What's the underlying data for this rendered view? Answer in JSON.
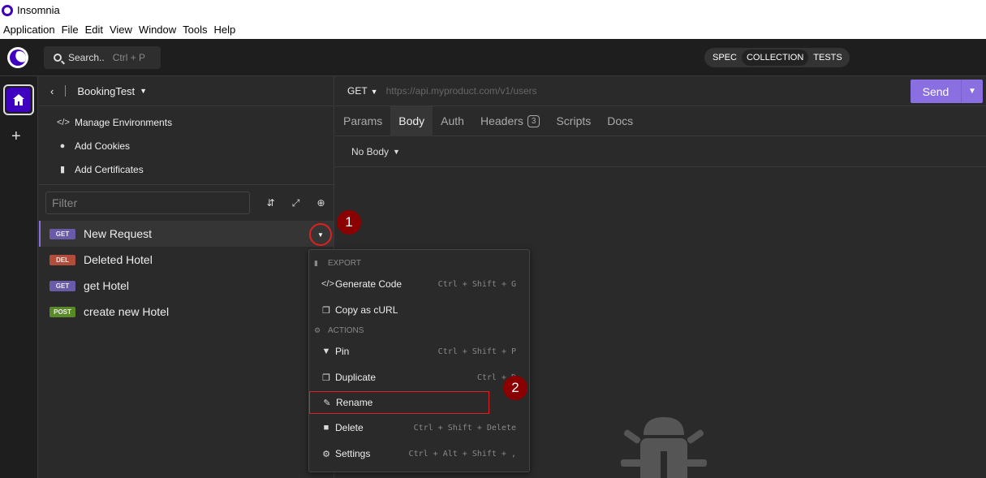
{
  "window": {
    "title": "Insomnia"
  },
  "menubar": [
    "Application",
    "File",
    "Edit",
    "View",
    "Window",
    "Tools",
    "Help"
  ],
  "topbar": {
    "search_label": "Search..",
    "search_shortcut": "Ctrl + P",
    "segments": [
      "SPEC",
      "COLLECTION",
      "TESTS"
    ],
    "active_segment": "COLLECTION"
  },
  "sidebar": {
    "project": "BookingTest",
    "links": [
      {
        "icon": "code-icon",
        "label": "Manage Environments"
      },
      {
        "icon": "cookie-icon",
        "label": "Add Cookies"
      },
      {
        "icon": "certificate-icon",
        "label": "Add Certificates"
      }
    ],
    "filter_placeholder": "Filter",
    "requests": [
      {
        "method": "GET",
        "name": "New Request",
        "active": true
      },
      {
        "method": "DEL",
        "name": "Deleted Hotel"
      },
      {
        "method": "GET",
        "name": "get Hotel"
      },
      {
        "method": "POST",
        "name": "create new Hotel"
      }
    ]
  },
  "request": {
    "method": "GET",
    "url_placeholder": "https://api.myproduct.com/v1/users",
    "send_label": "Send",
    "tabs": [
      "Params",
      "Body",
      "Auth",
      "Headers",
      "Scripts",
      "Docs"
    ],
    "active_tab": "Body",
    "headers_count": "3",
    "body_mode": "No Body"
  },
  "context_menu": {
    "export_label": "EXPORT",
    "actions_label": "ACTIONS",
    "items": [
      {
        "label": "Generate Code",
        "shortcut": "Ctrl + Shift + G"
      },
      {
        "label": "Copy as cURL",
        "shortcut": ""
      },
      {
        "label": "Pin",
        "shortcut": "Ctrl + Shift + P"
      },
      {
        "label": "Duplicate",
        "shortcut": "Ctrl + D"
      },
      {
        "label": "Rename",
        "shortcut": ""
      },
      {
        "label": "Delete",
        "shortcut": "Ctrl + Shift + Delete"
      },
      {
        "label": "Settings",
        "shortcut": "Ctrl + Alt + Shift + ,"
      }
    ]
  },
  "markers": [
    "1",
    "2"
  ],
  "colors": {
    "accent": "#8a6fe0",
    "brand": "#4000bf",
    "highlight": "#e02020",
    "marker": "#8b0000"
  }
}
